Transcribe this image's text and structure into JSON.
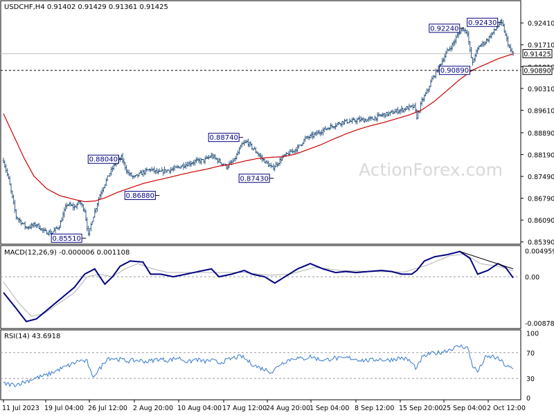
{
  "chart_data": [
    {
      "type": "candlestick",
      "title": "USDCHF,H4  0.91402 0.91429 0.91361 0.91425",
      "y_ticks": [
        "0.92410",
        "0.91710",
        "0.91010",
        "0.90310",
        "0.89610",
        "0.88890",
        "0.88190",
        "0.87490",
        "0.86790",
        "0.86090",
        "0.85390"
      ],
      "ylim": [
        0.8534,
        0.9268
      ],
      "x_ticks": [
        "11 Jul 2023",
        "19 Jul 04:00",
        "26 Jul 12:00",
        "2 Aug 20:00",
        "10 Aug 04:00",
        "17 Aug 12:00",
        "24 Aug 20:00",
        "1 Sep 04:00",
        "8 Sep 12:00",
        "15 Sep 20:00",
        "25 Sep 04:00",
        "2 Oct 12:00"
      ],
      "price_path": [
        [
          0,
          0.88
        ],
        [
          4,
          0.874
        ],
        [
          10,
          0.862
        ],
        [
          18,
          0.8585
        ],
        [
          26,
          0.8595
        ],
        [
          32,
          0.8572
        ],
        [
          38,
          0.8568
        ],
        [
          44,
          0.859
        ],
        [
          50,
          0.866
        ],
        [
          56,
          0.865
        ],
        [
          60,
          0.8668
        ],
        [
          64,
          0.864
        ],
        [
          67,
          0.856
        ],
        [
          70,
          0.861
        ],
        [
          76,
          0.869
        ],
        [
          82,
          0.8745
        ],
        [
          88,
          0.879
        ],
        [
          93,
          0.881
        ],
        [
          98,
          0.876
        ],
        [
          103,
          0.8745
        ],
        [
          110,
          0.8762
        ],
        [
          116,
          0.8772
        ],
        [
          122,
          0.876
        ],
        [
          128,
          0.8768
        ],
        [
          134,
          0.8772
        ],
        [
          140,
          0.8782
        ],
        [
          146,
          0.879
        ],
        [
          152,
          0.8798
        ],
        [
          158,
          0.88
        ],
        [
          164,
          0.8815
        ],
        [
          170,
          0.8798
        ],
        [
          176,
          0.878
        ],
        [
          182,
          0.88
        ],
        [
          188,
          0.885
        ],
        [
          192,
          0.886
        ],
        [
          196,
          0.8842
        ],
        [
          200,
          0.8825
        ],
        [
          204,
          0.8805
        ],
        [
          208,
          0.879
        ],
        [
          212,
          0.8775
        ],
        [
          216,
          0.879
        ],
        [
          220,
          0.881
        ],
        [
          226,
          0.8825
        ],
        [
          232,
          0.884
        ],
        [
          238,
          0.887
        ],
        [
          244,
          0.888
        ],
        [
          250,
          0.8893
        ],
        [
          256,
          0.8905
        ],
        [
          262,
          0.8915
        ],
        [
          268,
          0.8925
        ],
        [
          274,
          0.8925
        ],
        [
          280,
          0.893
        ],
        [
          286,
          0.893
        ],
        [
          292,
          0.8935
        ],
        [
          298,
          0.8945
        ],
        [
          304,
          0.895
        ],
        [
          310,
          0.8958
        ],
        [
          316,
          0.8965
        ],
        [
          320,
          0.897
        ],
        [
          324,
          0.8972
        ],
        [
          326,
          0.894
        ],
        [
          330,
          0.899
        ],
        [
          334,
          0.902
        ],
        [
          338,
          0.906
        ],
        [
          342,
          0.909
        ],
        [
          346,
          0.912
        ],
        [
          350,
          0.915
        ],
        [
          354,
          0.917
        ],
        [
          358,
          0.92
        ],
        [
          362,
          0.9224
        ],
        [
          366,
          0.921
        ],
        [
          368,
          0.915
        ],
        [
          370,
          0.911
        ],
        [
          372,
          0.914
        ],
        [
          376,
          0.917
        ],
        [
          380,
          0.918
        ],
        [
          384,
          0.92
        ],
        [
          388,
          0.922
        ],
        [
          392,
          0.9243
        ],
        [
          394,
          0.923
        ],
        [
          396,
          0.92
        ],
        [
          398,
          0.9175
        ],
        [
          400,
          0.915
        ],
        [
          402,
          0.9143
        ]
      ],
      "ma_path": [
        [
          0,
          0.895
        ],
        [
          8,
          0.888
        ],
        [
          16,
          0.881
        ],
        [
          24,
          0.875
        ],
        [
          34,
          0.871
        ],
        [
          44,
          0.8688
        ],
        [
          56,
          0.8675
        ],
        [
          64,
          0.8668
        ],
        [
          72,
          0.867
        ],
        [
          80,
          0.868
        ],
        [
          90,
          0.8698
        ],
        [
          100,
          0.8712
        ],
        [
          110,
          0.8726
        ],
        [
          120,
          0.8736
        ],
        [
          130,
          0.8745
        ],
        [
          140,
          0.8755
        ],
        [
          150,
          0.8764
        ],
        [
          160,
          0.8772
        ],
        [
          170,
          0.8782
        ],
        [
          180,
          0.8788
        ],
        [
          190,
          0.8798
        ],
        [
          200,
          0.8806
        ],
        [
          210,
          0.881
        ],
        [
          220,
          0.8812
        ],
        [
          230,
          0.882
        ],
        [
          240,
          0.8835
        ],
        [
          250,
          0.885
        ],
        [
          260,
          0.8868
        ],
        [
          270,
          0.8885
        ],
        [
          280,
          0.89
        ],
        [
          290,
          0.8912
        ],
        [
          300,
          0.8922
        ],
        [
          310,
          0.8934
        ],
        [
          320,
          0.8946
        ],
        [
          330,
          0.8962
        ],
        [
          340,
          0.899
        ],
        [
          350,
          0.9025
        ],
        [
          360,
          0.906
        ],
        [
          370,
          0.909
        ],
        [
          380,
          0.9108
        ],
        [
          390,
          0.9126
        ],
        [
          402,
          0.9142
        ]
      ],
      "annotations": [
        {
          "label": "0.85510",
          "price": 0.8551,
          "anchor": 64
        },
        {
          "label": "0.88040",
          "price": 0.8804,
          "anchor": 93
        },
        {
          "label": "0.86880",
          "price": 0.8688,
          "anchor": 122
        },
        {
          "label": "0.88740",
          "price": 0.8874,
          "anchor": 188
        },
        {
          "label": "0.87430",
          "price": 0.8743,
          "anchor": 212
        },
        {
          "label": "0.92240",
          "price": 0.9224,
          "anchor": 362
        },
        {
          "label": "0.90890",
          "price": 0.9089,
          "anchor": 370
        },
        {
          "label": "0.92430",
          "price": 0.9243,
          "anchor": 392
        }
      ],
      "current_price": {
        "label": "0.91425",
        "price": 0.91425
      },
      "support_level": {
        "label": "0.90890",
        "price": 0.9089
      },
      "watermark": "ActionForex.com"
    },
    {
      "type": "line",
      "title": "MACD(12,26,9) -0.000006 0.001108",
      "y_ticks": [
        "0.004959",
        "0.00",
        "-0.008785"
      ],
      "tick_values": [
        0.004959,
        0.0,
        -0.008785
      ],
      "ylim": [
        -0.0097,
        0.0058
      ],
      "macd_path": [
        [
          0,
          -0.003
        ],
        [
          10,
          -0.006
        ],
        [
          18,
          -0.0085
        ],
        [
          26,
          -0.008
        ],
        [
          36,
          -0.006
        ],
        [
          46,
          -0.004
        ],
        [
          56,
          -0.002
        ],
        [
          64,
          0.0005
        ],
        [
          72,
          0.0015
        ],
        [
          76,
          0.0
        ],
        [
          80,
          -0.0014
        ],
        [
          86,
          0.0
        ],
        [
          92,
          0.002
        ],
        [
          100,
          0.003
        ],
        [
          110,
          0.0028
        ],
        [
          116,
          0.0005
        ],
        [
          124,
          0.0005
        ],
        [
          134,
          0.0
        ],
        [
          144,
          0.0005
        ],
        [
          154,
          0.001
        ],
        [
          164,
          0.0015
        ],
        [
          170,
          0.0
        ],
        [
          180,
          0.0005
        ],
        [
          190,
          0.0012
        ],
        [
          196,
          0.0005
        ],
        [
          206,
          0.0
        ],
        [
          214,
          -0.0012
        ],
        [
          222,
          0.0
        ],
        [
          232,
          0.0015
        ],
        [
          242,
          0.0025
        ],
        [
          252,
          0.0015
        ],
        [
          262,
          0.0008
        ],
        [
          270,
          0.001
        ],
        [
          278,
          0.0008
        ],
        [
          288,
          0.001
        ],
        [
          298,
          0.0012
        ],
        [
          306,
          0.001
        ],
        [
          314,
          0.0005
        ],
        [
          322,
          0.0005
        ],
        [
          326,
          0.0012
        ],
        [
          332,
          0.003
        ],
        [
          340,
          0.0038
        ],
        [
          350,
          0.0042
        ],
        [
          360,
          0.0048
        ],
        [
          368,
          0.0035
        ],
        [
          374,
          0.0005
        ],
        [
          382,
          0.0012
        ],
        [
          390,
          0.0025
        ],
        [
          396,
          0.0018
        ],
        [
          402,
          -0.0002
        ]
      ],
      "signal_path": [
        [
          0,
          -0.001
        ],
        [
          12,
          -0.005
        ],
        [
          22,
          -0.0075
        ],
        [
          32,
          -0.007
        ],
        [
          44,
          -0.005
        ],
        [
          56,
          -0.003
        ],
        [
          66,
          0.0
        ],
        [
          76,
          0.0005
        ],
        [
          86,
          0.0
        ],
        [
          96,
          0.0015
        ],
        [
          106,
          0.0025
        ],
        [
          118,
          0.0015
        ],
        [
          130,
          0.0008
        ],
        [
          150,
          0.0008
        ],
        [
          170,
          0.0008
        ],
        [
          190,
          0.0008
        ],
        [
          210,
          0.0003
        ],
        [
          226,
          0.0005
        ],
        [
          246,
          0.0018
        ],
        [
          266,
          0.0012
        ],
        [
          290,
          0.001
        ],
        [
          316,
          0.0009
        ],
        [
          334,
          0.0022
        ],
        [
          352,
          0.004
        ],
        [
          364,
          0.0043
        ],
        [
          376,
          0.0025
        ],
        [
          390,
          0.002
        ],
        [
          402,
          0.0011
        ]
      ],
      "trendline": [
        [
          360,
          0.0048
        ],
        [
          402,
          0.0015
        ]
      ]
    },
    {
      "type": "line",
      "title": "RSI(14) 43.6918",
      "y_ticks": [
        "100",
        "70",
        "30",
        "0"
      ],
      "tick_values": [
        100,
        70,
        30,
        0
      ],
      "ylim": [
        -2,
        104
      ],
      "levels": [
        70,
        30
      ],
      "rsi_path": [
        [
          0,
          22
        ],
        [
          8,
          20
        ],
        [
          16,
          24
        ],
        [
          24,
          30
        ],
        [
          34,
          35
        ],
        [
          44,
          44
        ],
        [
          54,
          52
        ],
        [
          60,
          58
        ],
        [
          66,
          56
        ],
        [
          70,
          32
        ],
        [
          76,
          45
        ],
        [
          82,
          62
        ],
        [
          90,
          60
        ],
        [
          98,
          57
        ],
        [
          106,
          58
        ],
        [
          114,
          56
        ],
        [
          122,
          60
        ],
        [
          130,
          58
        ],
        [
          138,
          62
        ],
        [
          146,
          55
        ],
        [
          152,
          60
        ],
        [
          158,
          56
        ],
        [
          164,
          58
        ],
        [
          170,
          54
        ],
        [
          176,
          58
        ],
        [
          182,
          62
        ],
        [
          188,
          64
        ],
        [
          194,
          55
        ],
        [
          200,
          48
        ],
        [
          206,
          44
        ],
        [
          212,
          40
        ],
        [
          218,
          52
        ],
        [
          224,
          58
        ],
        [
          230,
          62
        ],
        [
          236,
          60
        ],
        [
          242,
          64
        ],
        [
          248,
          60
        ],
        [
          254,
          58
        ],
        [
          260,
          62
        ],
        [
          266,
          60
        ],
        [
          272,
          62
        ],
        [
          278,
          60
        ],
        [
          284,
          58
        ],
        [
          290,
          58
        ],
        [
          296,
          60
        ],
        [
          302,
          58
        ],
        [
          308,
          60
        ],
        [
          314,
          62
        ],
        [
          320,
          58
        ],
        [
          326,
          45
        ],
        [
          330,
          62
        ],
        [
          336,
          68
        ],
        [
          344,
          70
        ],
        [
          352,
          75
        ],
        [
          360,
          80
        ],
        [
          366,
          78
        ],
        [
          370,
          50
        ],
        [
          374,
          40
        ],
        [
          380,
          62
        ],
        [
          386,
          64
        ],
        [
          392,
          58
        ],
        [
          396,
          50
        ],
        [
          402,
          44
        ]
      ]
    }
  ]
}
